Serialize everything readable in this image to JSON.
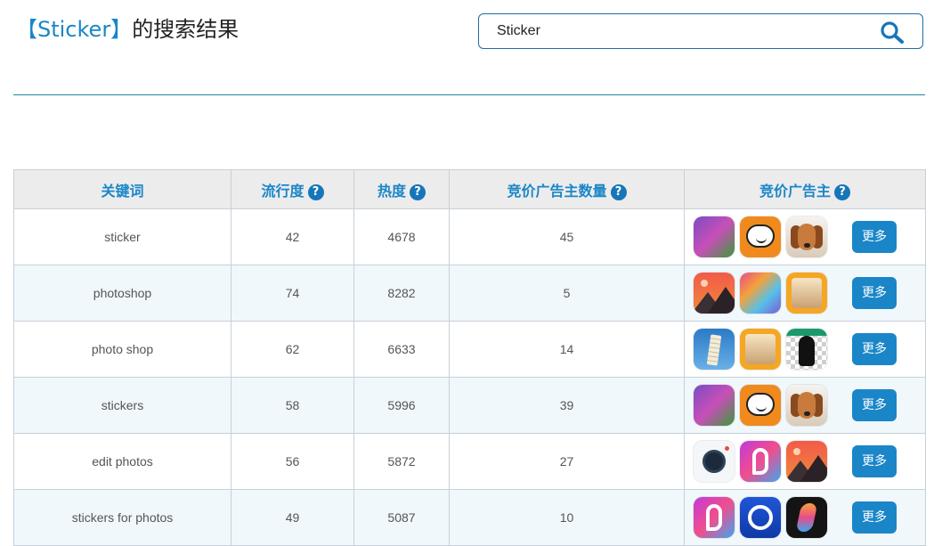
{
  "page": {
    "title_keyword": "【Sticker】",
    "title_suffix": "的搜索结果"
  },
  "search": {
    "value": "Sticker",
    "button_icon": "search-icon"
  },
  "colors": {
    "accent": "#1a86c8",
    "divider": "#1f8a9e",
    "header_bg": "#ececec",
    "stripe_bg": "#f1f8fc"
  },
  "table": {
    "headers": {
      "keyword": "关键词",
      "popularity": "流行度",
      "heat": "热度",
      "advertiser_count": "竞价广告主数量",
      "advertisers": "竞价广告主"
    },
    "help_glyph": "?",
    "more_label": "更多",
    "rows": [
      {
        "keyword": "sticker",
        "popularity": "42",
        "heat": "4678",
        "advertiser_count": "45",
        "icons": [
          "princess-sticker-app-icon",
          "speech-face-app-icon",
          "beagle-dog-app-icon"
        ]
      },
      {
        "keyword": "photoshop",
        "popularity": "74",
        "heat": "8282",
        "advertiser_count": "5",
        "icons": [
          "mountain-gallery-app-icon",
          "rainbow-photoshop-app-icon",
          "pro-frame-app-icon"
        ]
      },
      {
        "keyword": "photo shop",
        "popularity": "62",
        "heat": "6633",
        "advertiser_count": "14",
        "icons": [
          "pisa-tower-app-icon",
          "pro-frame-app-icon",
          "cutout-silhouette-app-icon"
        ]
      },
      {
        "keyword": "stickers",
        "popularity": "58",
        "heat": "5996",
        "advertiser_count": "39",
        "icons": [
          "princess-sticker-app-icon",
          "speech-face-app-icon",
          "beagle-dog-app-icon"
        ]
      },
      {
        "keyword": "edit photos",
        "popularity": "56",
        "heat": "5872",
        "advertiser_count": "27",
        "icons": [
          "camera-lens-app-icon",
          "picsart-app-icon",
          "mountain-gallery-app-icon"
        ]
      },
      {
        "keyword": "stickers for photos",
        "popularity": "49",
        "heat": "5087",
        "advertiser_count": "10",
        "icons": [
          "picsart-app-icon",
          "q-ring-app-icon",
          "s-gradient-app-icon"
        ]
      }
    ]
  }
}
